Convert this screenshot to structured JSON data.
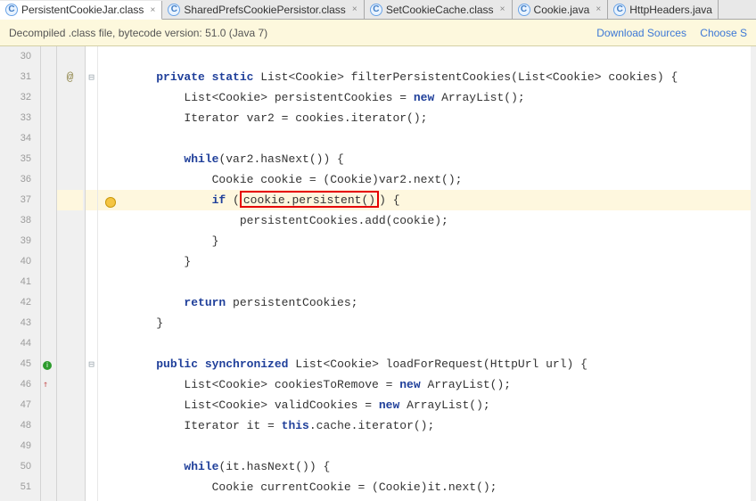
{
  "tabs": [
    {
      "label": "PersistentCookieJar.class",
      "active": true,
      "icon": "c",
      "closeable": true
    },
    {
      "label": "SharedPrefsCookiePersistor.class",
      "active": false,
      "icon": "c",
      "closeable": true
    },
    {
      "label": "SetCookieCache.class",
      "active": false,
      "icon": "c",
      "closeable": true
    },
    {
      "label": "Cookie.java",
      "active": false,
      "icon": "c",
      "closeable": true
    },
    {
      "label": "HttpHeaders.java",
      "active": false,
      "icon": "c",
      "closeable": false
    }
  ],
  "info_bar": {
    "message": "Decompiled .class file, bytecode version: 51.0 (Java 7)",
    "link_download": "Download Sources",
    "link_choose": "Choose S"
  },
  "lines": {
    "l30": "30",
    "l31": "31",
    "l32": "32",
    "l33": "33",
    "l34": "34",
    "l35": "35",
    "l36": "36",
    "l37": "37",
    "l38": "38",
    "l39": "39",
    "l40": "40",
    "l41": "41",
    "l42": "42",
    "l43": "43",
    "l44": "44",
    "l45": "45",
    "l46": "46",
    "l47": "47",
    "l48": "48",
    "l49": "49",
    "l50": "50",
    "l51": "51"
  },
  "annotation": "@",
  "code": {
    "k_private": "private",
    "k_static": "static",
    "k_new": "new",
    "k_while": "while",
    "k_if": "if",
    "k_return": "return",
    "k_public": "public",
    "k_synchronized": "synchronized",
    "k_this": "this",
    "c31a": " List<Cookie> filterPersistentCookies(List<Cookie> cookies) {",
    "c32a": "        List<Cookie> persistentCookies = ",
    "c32b": " ArrayList();",
    "c33": "        Iterator var2 = cookies.iterator();",
    "c35a": "        ",
    "c35b": "(var2.hasNext()) {",
    "c36": "            Cookie cookie = (Cookie)var2.next();",
    "c37a": "            ",
    "c37b": "cookie.persistent()",
    "c37c": " {",
    "c37sp": " (",
    "c37cp": ")",
    "c38": "                persistentCookies.add(cookie);",
    "c39": "            }",
    "c40": "        }",
    "c42a": "        ",
    "c42b": " persistentCookies;",
    "c43": "    }",
    "c45a": " List<Cookie> loadForRequest(HttpUrl url) {",
    "c46a": "        List<Cookie> cookiesToRemove = ",
    "c46b": " ArrayList();",
    "c47a": "        List<Cookie> validCookies = ",
    "c47b": " ArrayList();",
    "c48a": "        Iterator it = ",
    "c48b": ".cache.iterator();",
    "c50a": "        ",
    "c50b": "(it.hasNext()) {",
    "c51": "            Cookie currentCookie = (Cookie)it.next();",
    "indent1": "    "
  }
}
